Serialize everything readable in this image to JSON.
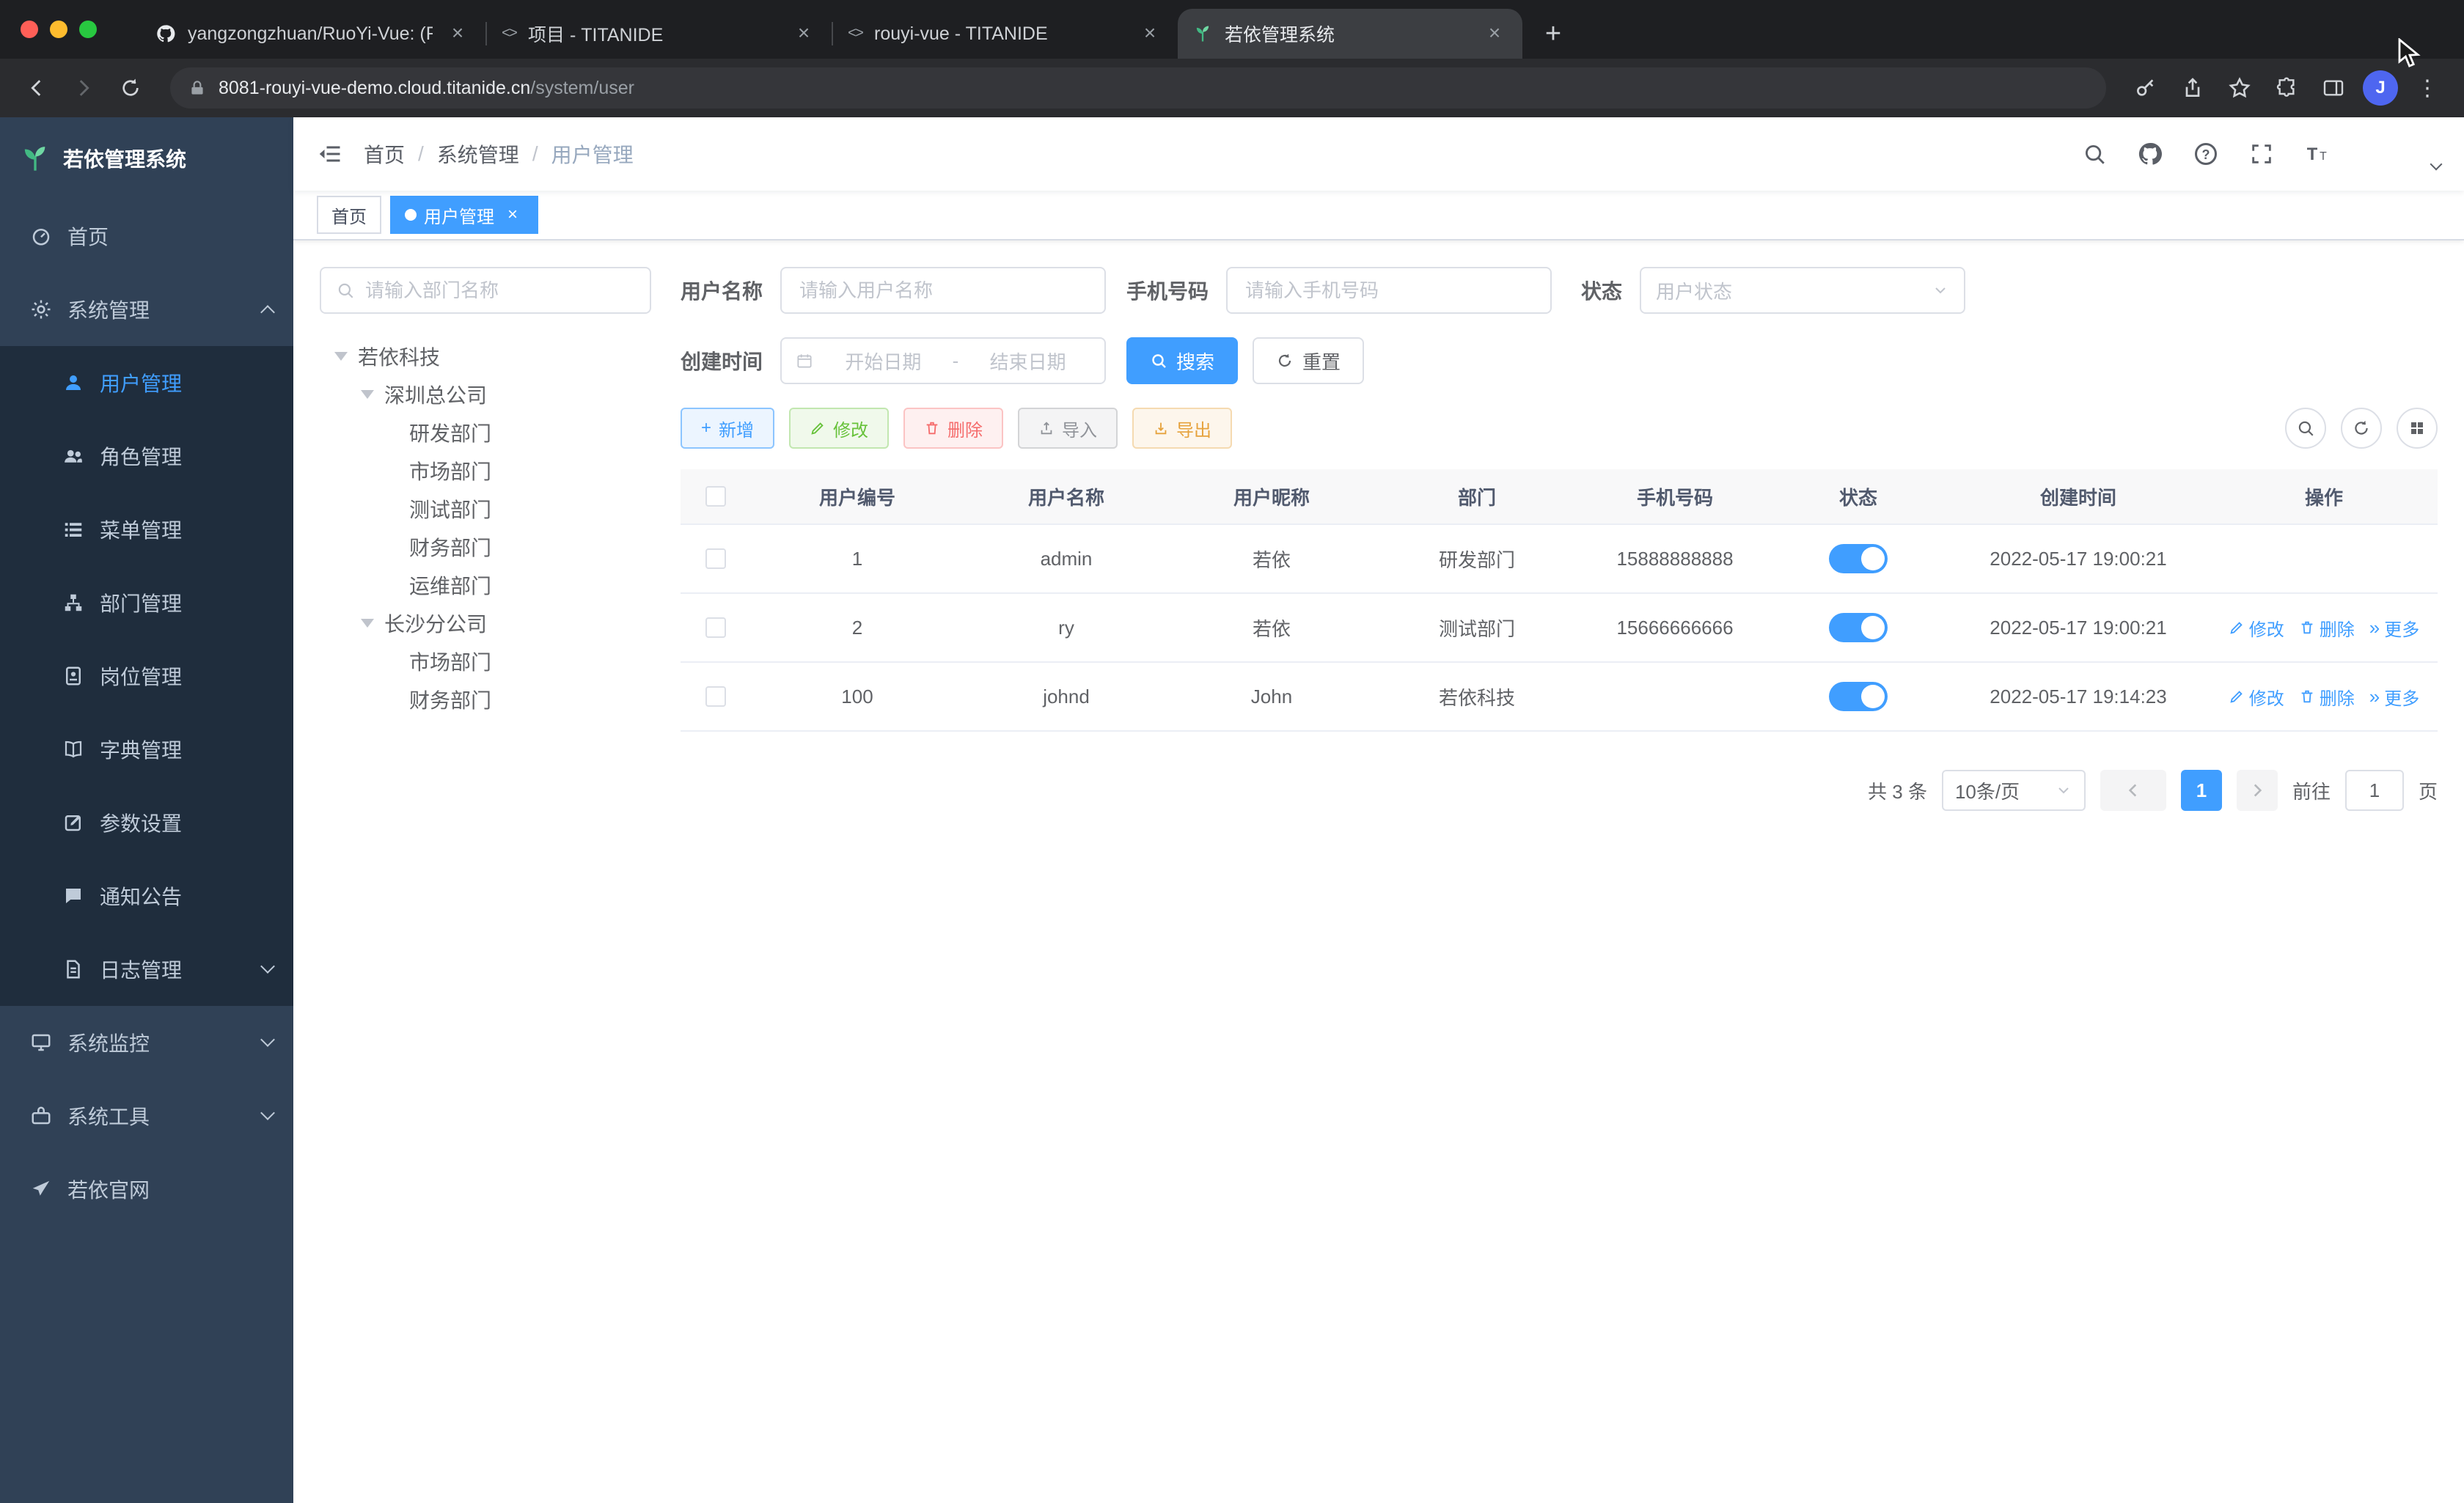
{
  "browser": {
    "tabs": [
      {
        "title": "yangzongzhuan/RuoYi-Vue: (R"
      },
      {
        "title": "项目 - TITANIDE"
      },
      {
        "title": "rouyi-vue - TITANIDE"
      },
      {
        "title": "若依管理系统"
      }
    ],
    "url_host": "8081-rouyi-vue-demo.cloud.titanide.cn",
    "url_path": "/system/user",
    "profile_initial": "J"
  },
  "icons": {
    "code_tab": "<>",
    "close": "×",
    "plus": "+",
    "kebab": "⋮",
    "more": "»"
  },
  "sidebar": {
    "logo_title": "若依管理系统",
    "home": "首页",
    "system": "系统管理",
    "monitor": "系统监控",
    "tools": "系统工具",
    "site": "若依官网",
    "system_children": [
      "用户管理",
      "角色管理",
      "菜单管理",
      "部门管理",
      "岗位管理",
      "字典管理",
      "参数设置",
      "通知公告",
      "日志管理"
    ]
  },
  "breadcrumb": {
    "items": [
      "首页",
      "系统管理",
      "用户管理"
    ],
    "separator": "/"
  },
  "tags": [
    {
      "label": "首页"
    },
    {
      "label": "用户管理"
    }
  ],
  "dept": {
    "search_placeholder": "请输入部门名称",
    "nodes": [
      {
        "label": "若依科技"
      },
      {
        "label": "深圳总公司"
      },
      {
        "label": "研发部门"
      },
      {
        "label": "市场部门"
      },
      {
        "label": "测试部门"
      },
      {
        "label": "财务部门"
      },
      {
        "label": "运维部门"
      },
      {
        "label": "长沙分公司"
      },
      {
        "label": "市场部门"
      },
      {
        "label": "财务部门"
      }
    ]
  },
  "filters": {
    "username_label": "用户名称",
    "username_placeholder": "请输入用户名称",
    "phone_label": "手机号码",
    "phone_placeholder": "请输入手机号码",
    "status_label": "状态",
    "status_placeholder": "用户状态",
    "date_label": "创建时间",
    "date_start": "开始日期",
    "date_sep": "-",
    "date_end": "结束日期",
    "search": "搜索",
    "reset": "重置"
  },
  "actions": {
    "add": "新增",
    "edit": "修改",
    "del": "删除",
    "imp": "导入",
    "exp": "导出"
  },
  "table": {
    "columns": [
      "用户编号",
      "用户名称",
      "用户昵称",
      "部门",
      "手机号码",
      "状态",
      "创建时间",
      "操作"
    ],
    "rows": [
      {
        "id": "1",
        "username": "admin",
        "nickname": "若依",
        "dept": "研发部门",
        "phone": "15888888888",
        "created": "2022-05-17 19:00:21"
      },
      {
        "id": "2",
        "username": "ry",
        "nickname": "若依",
        "dept": "测试部门",
        "phone": "15666666666",
        "created": "2022-05-17 19:00:21"
      },
      {
        "id": "100",
        "username": "johnd",
        "nickname": "John",
        "dept": "若依科技",
        "phone": "",
        "created": "2022-05-17 19:14:23"
      }
    ],
    "row_actions": {
      "edit": "修改",
      "del": "删除",
      "more": "更多"
    }
  },
  "pagination": {
    "total": "共 3 条",
    "size": "10条/页",
    "page": "1",
    "goto": "前往",
    "goto_value": "1",
    "unit": "页"
  }
}
